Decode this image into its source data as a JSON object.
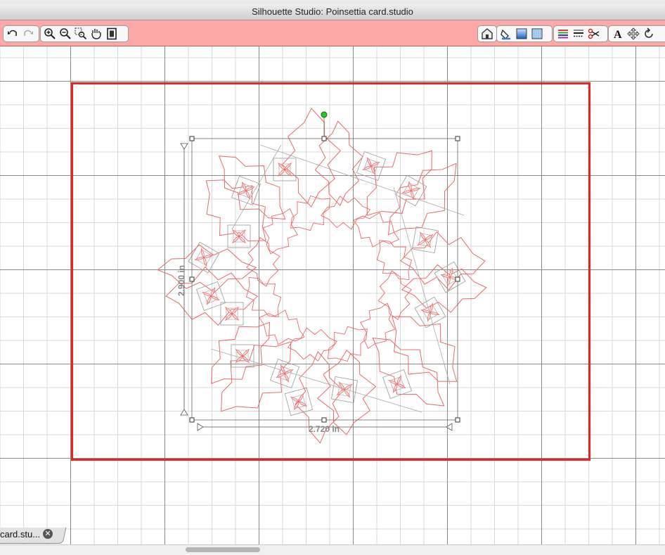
{
  "window": {
    "title": "Silhouette Studio: Poinsettia card.studio"
  },
  "toolbar": {
    "left_groups": [
      [
        "undo-icon",
        "redo-icon"
      ],
      [
        "zoom-in-icon",
        "zoom-out-icon",
        "zoom-region-icon",
        "pan-icon",
        "fit-page-icon"
      ]
    ],
    "right_groups": [
      [
        "store-icon"
      ],
      [
        "fill-icon",
        "gradient-icon",
        "pattern-icon"
      ],
      [
        "line-color-icon",
        "line-style-icon",
        "cut-style-icon"
      ],
      [
        "text-style-icon",
        "transform-icon",
        "replicate-icon"
      ]
    ]
  },
  "selection": {
    "width_label": "2.720 in",
    "height_label": "2.900 in"
  },
  "colors": {
    "toolbar_bg": "#ffa8a8",
    "cut_border": "#ee2020",
    "shape_outline": "#f06868",
    "rotate_handle": "#22cc22"
  },
  "document_tab": {
    "label": "card.stu...",
    "close_icon": "close-icon"
  }
}
